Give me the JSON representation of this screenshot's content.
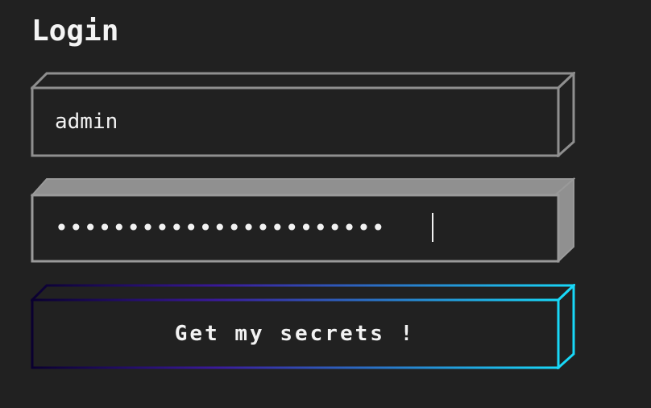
{
  "page": {
    "title": "Login"
  },
  "form": {
    "username": {
      "value": "admin"
    },
    "password": {
      "masked_value": "•••••••••••••••••••••••"
    },
    "submit_label": "Get my secrets !"
  },
  "colors": {
    "background": "#212121",
    "text": "#f2f2f2",
    "field_border": "#8f8f8f",
    "field_border_active": "#9a9a9a",
    "button_gradient_start": "#0a0030",
    "button_gradient_mid": "#3a1a9a",
    "button_gradient_end": "#18d8f8"
  }
}
